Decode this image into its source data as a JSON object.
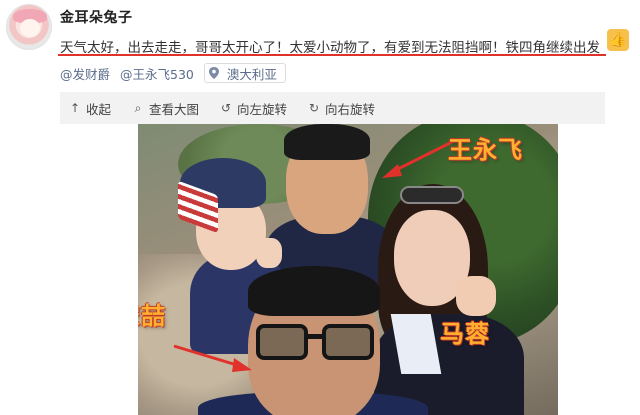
{
  "post": {
    "username": "金耳朵兔子",
    "text": "天气太好，出去走走，哥哥太开心了！太爱小动物了，有爱到无法阻挡啊！铁四角继续出发",
    "emoji": "thumbs-up-icon",
    "mentions": [
      "@发财爵",
      "@王永飞530"
    ],
    "location": "澳大利亚"
  },
  "toolbar": {
    "collect": "收起",
    "view_large": "查看大图",
    "rotate_left": "向左旋转",
    "rotate_right": "向右旋转"
  },
  "photo": {
    "labels": {
      "wang": "王永飞",
      "song": "宋喆",
      "ma": "马蓉"
    }
  },
  "colors": {
    "underline": "#e0312b",
    "label_fill": "#ffb02e",
    "label_outline": "#c0392b",
    "link": "#5b6d8c"
  }
}
